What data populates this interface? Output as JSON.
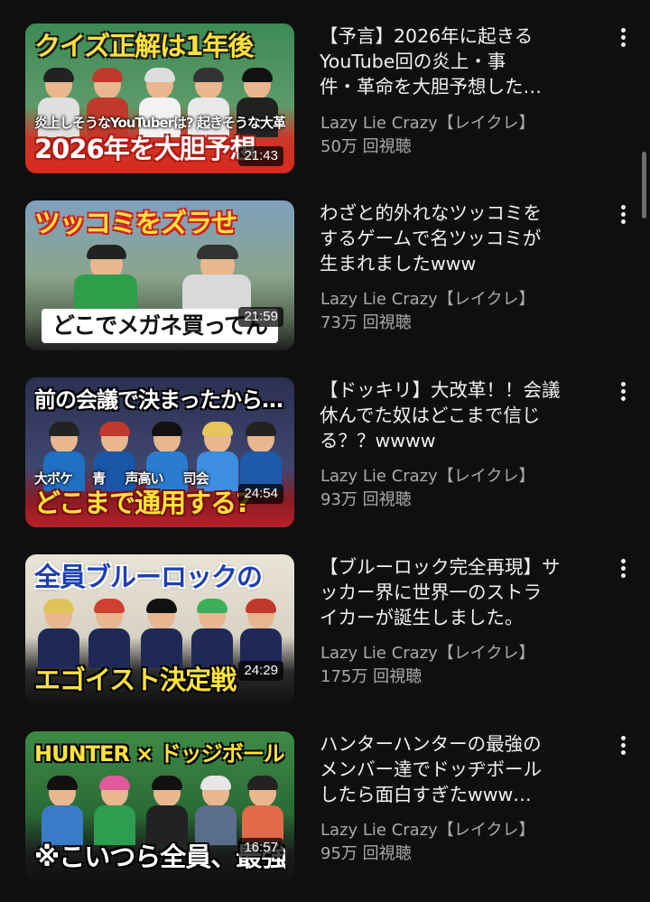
{
  "videos": [
    {
      "title": "【予言】2026年に起きる\nYouTube回の炎上・事\n件・革命を大胆予想した…",
      "channel": "Lazy Lie Crazy【レイクレ】",
      "views": "50万 回視聴",
      "duration": "21:43",
      "thumb_top": "クイズ正解は1年後",
      "thumb_mid": "炎上しそうなYouTuberは? 起きそうな大革命は?",
      "thumb_bottom": "2026年を大胆予想",
      "colors": {
        "bg": "#2f7a46",
        "top": "#ffe23a",
        "bottom": "#ffffff",
        "bottom_bg": "#d92a1d"
      }
    },
    {
      "title": "わざと的外れなツッコミを\nするゲームで名ツッコミが\n生まれましたwww",
      "channel": "Lazy Lie Crazy【レイクレ】",
      "views": "73万 回視聴",
      "duration": "21:59",
      "thumb_top": "ツッコミをズラせ",
      "thumb_bottom": "どこでメガネ買ってん",
      "colors": {
        "bg": "#6b8aa6",
        "top": "#ffe23a",
        "bottom": "#111111",
        "bottom_bg": "#ffffff"
      }
    },
    {
      "title": "【ドッキリ】大改革！！会議\n休んでた奴はどこまで信じ\nる？？wwww",
      "channel": "Lazy Lie Crazy【レイクレ】",
      "views": "93万 回視聴",
      "duration": "24:54",
      "thumb_top": "前の会議で決まったから…",
      "thumb_mid": "大ボケ 青 声高い 司会",
      "thumb_bottom": "どこまで通用する?",
      "colors": {
        "bg": "#3a3f63",
        "top": "#ffffff",
        "bottom": "#ffe23a",
        "bottom_bg": "#c7202b"
      }
    },
    {
      "title": "【ブルーロック完全再現】サ\nッカー界に世界一のストラ\nイカーが誕生しました。",
      "channel": "Lazy Lie Crazy【レイクレ】",
      "views": "175万 回視聴",
      "duration": "24:29",
      "thumb_top": "全員ブルーロックの",
      "thumb_bottom": "エゴイスト決定戦",
      "colors": {
        "bg": "#d8d2c4",
        "top": "#1d3fb5",
        "bottom": "#ffe23a",
        "bottom_bg": "#111111"
      }
    },
    {
      "title": "ハンターハンターの最強の\nメンバー達でドッヂボール\nしたら面白すぎたwww…",
      "channel": "Lazy Lie Crazy【レイクレ】",
      "views": "95万 回視聴",
      "duration": "16:57",
      "thumb_top": "HUNTER × ドッジボール",
      "thumb_bottom": "※こいつら全員、最強",
      "colors": {
        "bg": "#2a6a35",
        "top": "#ffe23a",
        "bottom": "#ffffff",
        "bottom_bg": "#1a1a1a"
      }
    }
  ]
}
